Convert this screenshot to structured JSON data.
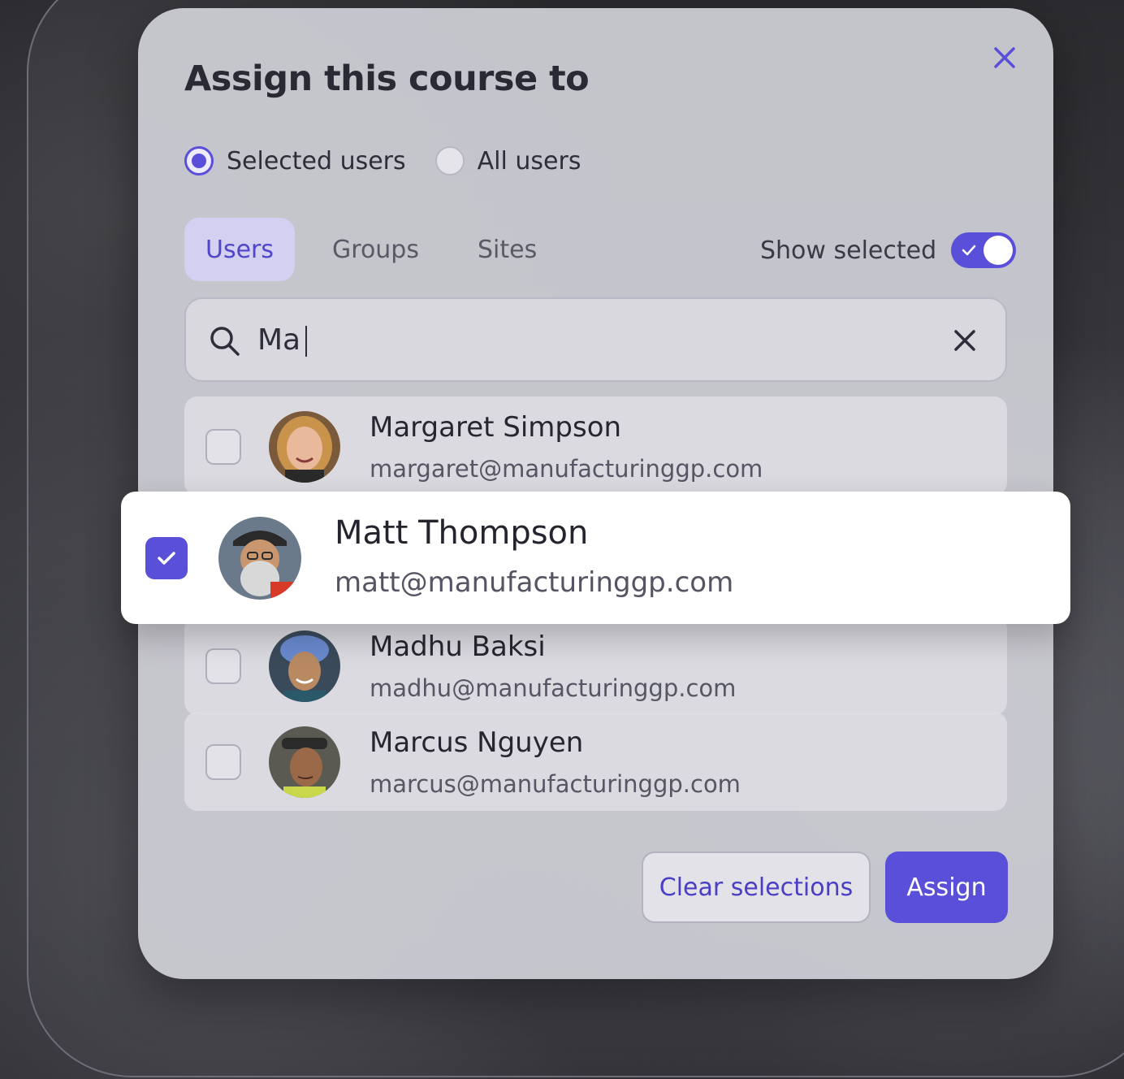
{
  "modal": {
    "title": "Assign this course to"
  },
  "assign_mode": {
    "options": [
      {
        "label": "Selected users",
        "checked": true
      },
      {
        "label": "All users",
        "checked": false
      }
    ]
  },
  "tabs": [
    {
      "label": "Users",
      "active": true
    },
    {
      "label": "Groups",
      "active": false
    },
    {
      "label": "Sites",
      "active": false
    }
  ],
  "show_selected": {
    "label": "Show selected",
    "enabled": true
  },
  "search": {
    "value": "Ma"
  },
  "users": [
    {
      "name": "Margaret Simpson",
      "email": "margaret@manufacturinggp.com",
      "selected": false
    },
    {
      "name": "Matt Thompson",
      "email": "matt@manufacturinggp.com",
      "selected": true
    },
    {
      "name": "Madhu Baksi",
      "email": "madhu@manufacturinggp.com",
      "selected": false
    },
    {
      "name": "Marcus Nguyen",
      "email": "marcus@manufacturinggp.com",
      "selected": false
    }
  ],
  "footer": {
    "clear_label": "Clear selections",
    "assign_label": "Assign"
  },
  "colors": {
    "accent": "#5a4fd8",
    "modal_bg": "#d0d0d7",
    "text": "#2a2a35"
  }
}
